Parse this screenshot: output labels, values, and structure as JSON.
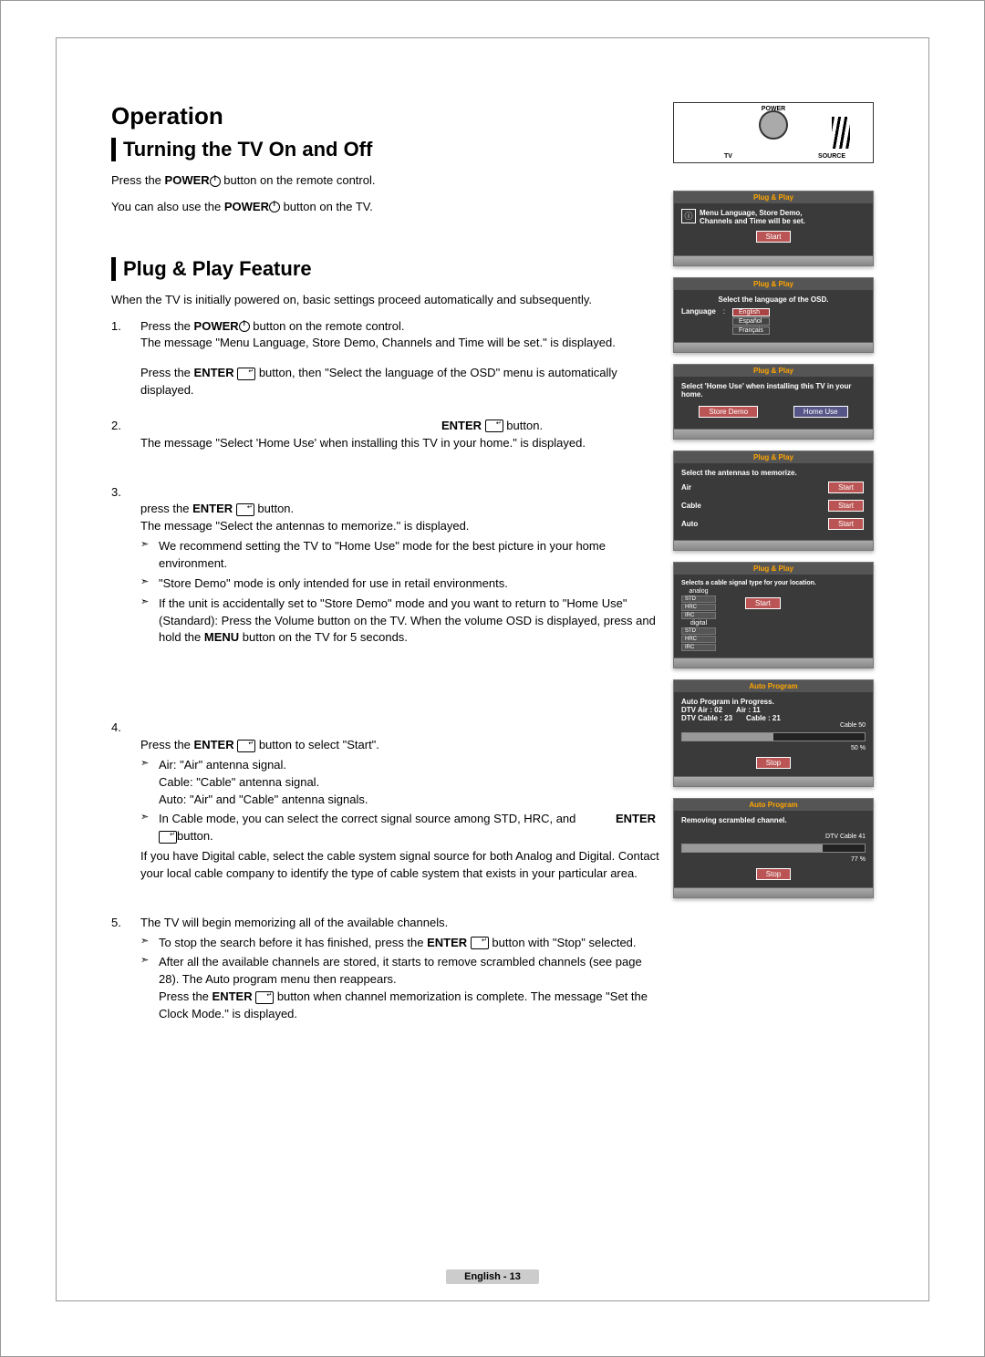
{
  "headings": {
    "operation": "Operation",
    "turning": "Turning the TV On and Off",
    "plug": "Plug & Play Feature"
  },
  "intro": {
    "l1a": "Press the ",
    "l1b": "POWER",
    "l1c": " button on the remote control.",
    "l2a": "You can also use the ",
    "l2b": "POWER",
    "l2c": " button on the TV."
  },
  "plug_intro": "When the TV is initially powered on, basic settings proceed automatically and subsequently.",
  "step1": {
    "a": "Press the ",
    "b": "POWER",
    "c": " button on the remote control.",
    "d": "The message \"Menu Language, Store Demo, Channels and Time will be set.\" is displayed.",
    "e": "Press the ",
    "f": "ENTER",
    "g": " button, then \"Select the language of the OSD\" menu is automatically displayed."
  },
  "step2": {
    "a": "ENTER",
    "b": " button.",
    "c": "The message \"Select 'Home Use' when installing this TV in your home.\" is displayed."
  },
  "step3": {
    "a": "press the ",
    "b": "ENTER",
    "c": " button.",
    "d": "The message \"Select the antennas to memorize.\" is displayed.",
    "n1": "We recommend setting the TV to \"Home Use\" mode for the best picture in your home environment.",
    "n2": "\"Store Demo\" mode is only intended for use in retail environments.",
    "n3a": "If the unit is accidentally set to \"Store Demo\" mode and you want to return to \"Home Use\" (Standard): Press the Volume button on the TV. When the volume OSD is displayed, press and hold the ",
    "n3b": "MENU",
    "n3c": " button on the TV for 5 seconds."
  },
  "step4": {
    "a": "Press the ",
    "b": "ENTER",
    "c": " button to select \"Start\".",
    "n1": "Air: \"Air\" antenna signal.\nCable: \"Cable\" antenna signal.\nAuto: \"Air\" and \"Cable\" antenna signals.",
    "n2a": "In Cable mode, you can select the correct signal source among STD, HRC, and ",
    "n2b": "ENTER",
    "n2c": "button.",
    "d": "If you have Digital cable, select the cable system signal source for both Analog and Digital. Contact your local cable company to identify the type of cable system that exists in your particular area."
  },
  "step5": {
    "a": "The TV will begin memorizing all of the available channels.",
    "n1a": "To stop the search before it has finished, press the ",
    "n1b": "ENTER",
    "n1c": " button with \"Stop\" selected.",
    "n2a": "After all the available channels are stored, it starts to remove scrambled channels (see page 28). The Auto program menu then reappears.\nPress the ",
    "n2b": "ENTER",
    "n2c": " button when channel memorization is complete. The message \"Set the Clock Mode.\" is displayed."
  },
  "remote": {
    "power": "POWER",
    "tv": "TV",
    "source": "SOURCE"
  },
  "osd1": {
    "title": "Plug & Play",
    "msg": "Menu Language, Store Demo,\nChannels and Time will be set.",
    "btn": "Start"
  },
  "osd2": {
    "title": "Plug & Play",
    "msg": "Select the language of the OSD.",
    "lang": "Language",
    "o1": "English",
    "o2": "Español",
    "o3": "Français"
  },
  "osd3": {
    "title": "Plug & Play",
    "msg": "Select 'Home Use' when installing this TV in your home.",
    "b1": "Store Demo",
    "b2": "Home Use"
  },
  "osd4": {
    "title": "Plug & Play",
    "msg": "Select the antennas to memorize.",
    "r1": "Air",
    "r2": "Cable",
    "r3": "Auto",
    "btn": "Start"
  },
  "osd5": {
    "title": "Plug & Play",
    "msg": "Selects a cable signal type for your location.",
    "analog": "analog",
    "digital": "digital",
    "s1": "STD",
    "s2": "HRC",
    "s3": "IRC",
    "btn": "Start"
  },
  "osd6": {
    "title": "Auto Program",
    "msg": "Auto Program in Progress.",
    "l1": "DTV Air : 02",
    "l2": "Air : 11",
    "l3": "DTV Cable : 23",
    "l4": "Cable : 21",
    "p1": "Cable  50",
    "p2": "50  %",
    "btn": "Stop"
  },
  "osd7": {
    "title": "Auto Program",
    "msg": "Removing scrambled channel.",
    "p1": "DTV Cable  41",
    "p2": "77  %",
    "btn": "Stop"
  },
  "footer": "English - 13"
}
